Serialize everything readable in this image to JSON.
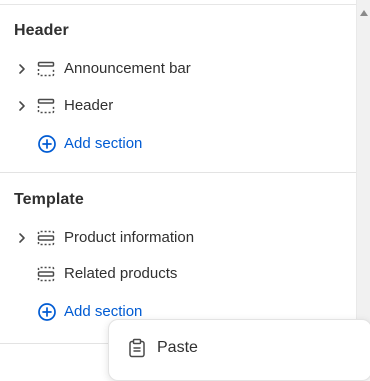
{
  "sections": {
    "header": {
      "title": "Header",
      "items": [
        {
          "label": "Announcement bar",
          "icon": "header-section-icon"
        },
        {
          "label": "Header",
          "icon": "header-section-icon"
        }
      ],
      "add_label": "Add section"
    },
    "template": {
      "title": "Template",
      "items": [
        {
          "label": "Product information",
          "icon": "template-section-icon"
        },
        {
          "label": "Related products",
          "icon": "template-section-icon"
        }
      ],
      "add_label": "Add section"
    }
  },
  "context_menu": {
    "paste_label": "Paste",
    "paste_icon": "clipboard-icon"
  },
  "colors": {
    "link": "#005bd3",
    "text": "#303030",
    "icon": "#4a4a4a"
  }
}
